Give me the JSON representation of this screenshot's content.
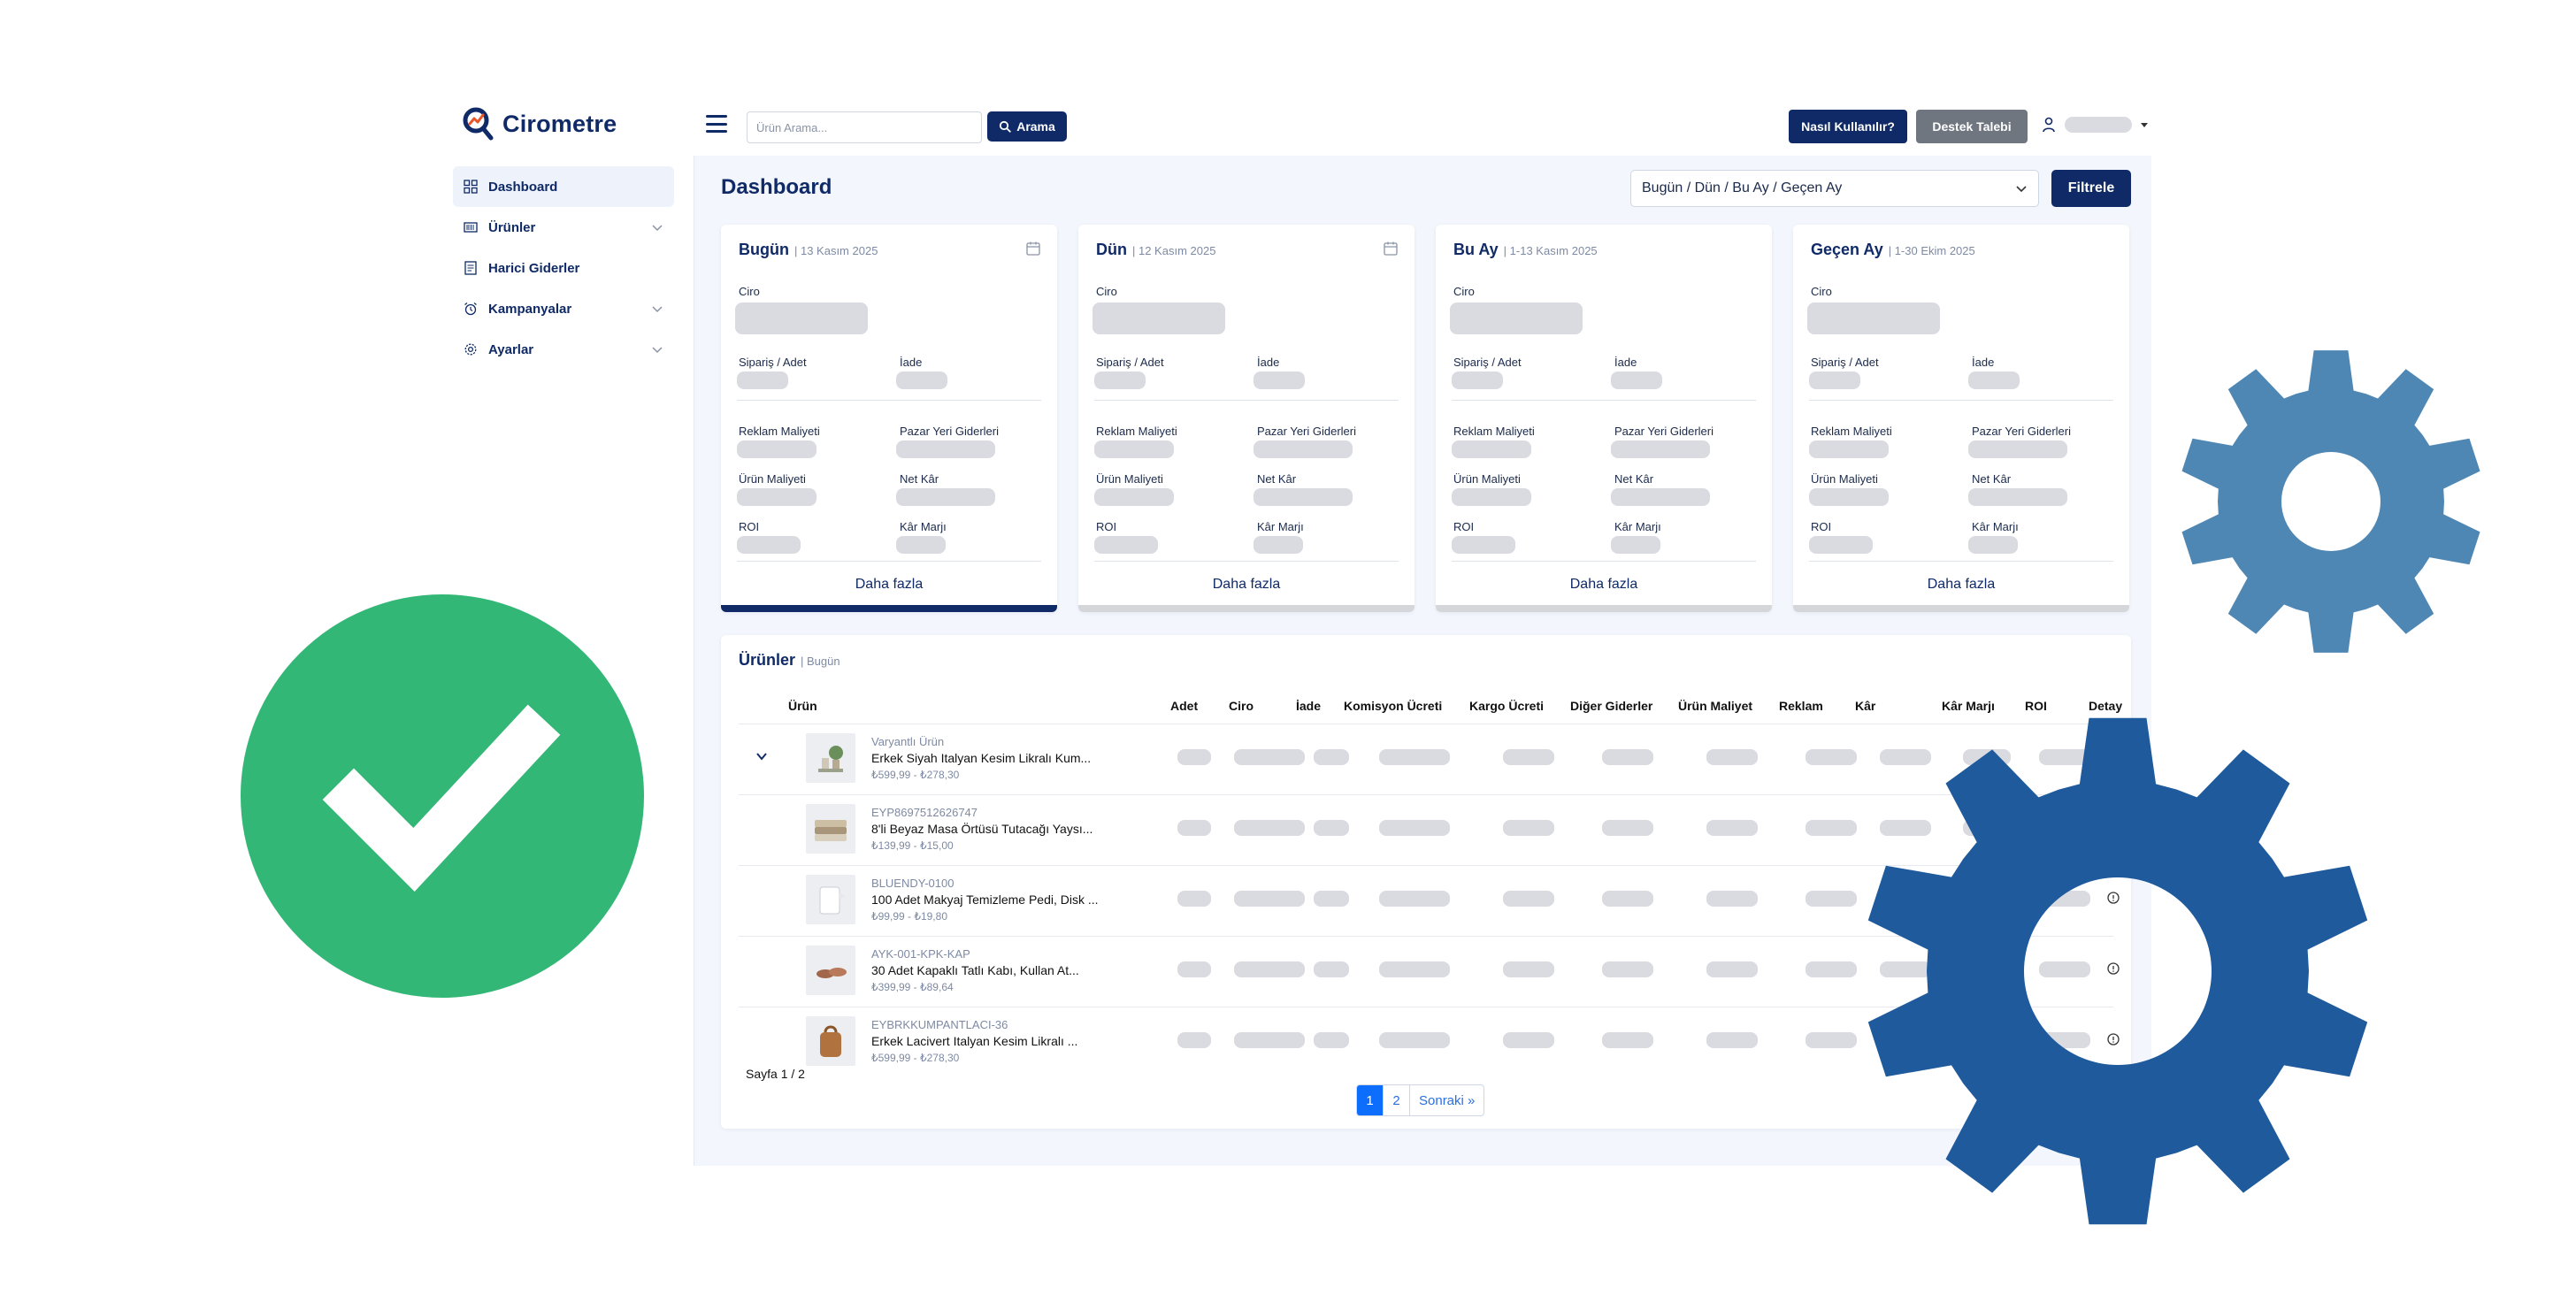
{
  "app": {
    "brand": "Cirometre",
    "search_placeholder": "Ürün Arama...",
    "search_button": "Arama",
    "howto_button": "Nasıl Kullanılır?",
    "support_button": "Destek Talebi"
  },
  "sidebar": {
    "items": [
      {
        "label": "Dashboard",
        "icon": "grid-icon"
      },
      {
        "label": "Ürünler",
        "icon": "barcode-icon"
      },
      {
        "label": "Harici Giderler",
        "icon": "document-icon"
      },
      {
        "label": "Kampanyalar",
        "icon": "alarm-icon"
      },
      {
        "label": "Ayarlar",
        "icon": "gear-icon"
      }
    ]
  },
  "dashboard": {
    "title": "Dashboard",
    "period_selected": "Bugün / Dün / Bu Ay / Geçen Ay",
    "filter_button": "Filtrele"
  },
  "cards": [
    {
      "title": "Bugün",
      "date": "| 13 Kasım 2025"
    },
    {
      "title": "Dün",
      "date": "| 12 Kasım 2025"
    },
    {
      "title": "Bu Ay",
      "date": "| 1-13 Kasım 2025"
    },
    {
      "title": "Geçen Ay",
      "date": "| 1-30 Ekim 2025"
    }
  ],
  "card_labels": {
    "ciro": "Ciro",
    "siparis": "Sipariş / Adet",
    "iade": "İade",
    "reklam": "Reklam Maliyeti",
    "pazar": "Pazar Yeri Giderleri",
    "urun_maliyet": "Ürün Maliyeti",
    "net_kar": "Net Kâr",
    "roi": "ROI",
    "kar_marji": "Kâr Marjı",
    "more": "Daha fazla"
  },
  "products": {
    "title": "Ürünler",
    "subtitle": "| Bugün",
    "headers": [
      "Ürün",
      "Adet",
      "Ciro",
      "İade",
      "Komisyon Ücreti",
      "Kargo Ücreti",
      "Diğer Giderler",
      "Ürün Maliyet",
      "Reklam",
      "Kâr",
      "Kâr Marjı",
      "ROI",
      "Detay"
    ],
    "rows": [
      {
        "sku": "Varyantlı Ürün",
        "name": "Erkek Siyah Italyan Kesim Likralı Kum...",
        "price": "₺599,99 - ₺278,30"
      },
      {
        "sku": "EYP8697512626747",
        "name": "8'li Beyaz Masa Örtüsü Tutacağı Yaysı...",
        "price": "₺139,99 - ₺15,00"
      },
      {
        "sku": "BLUENDY-0100",
        "name": "100 Adet Makyaj Temizleme Pedi, Disk ...",
        "price": "₺99,99 - ₺19,80"
      },
      {
        "sku": "AYK-001-KPK-KAP",
        "name": "30 Adet Kapaklı Tatlı Kabı, Kullan At...",
        "price": "₺399,99 - ₺89,64"
      },
      {
        "sku": "EYBRKKUMPANTLACI-36",
        "name": "Erkek Lacivert Italyan Kesim Likralı ...",
        "price": "₺599,99 - ₺278,30"
      }
    ],
    "page_info": "Sayfa 1 / 2",
    "pages": [
      "1",
      "2",
      "Sonraki »"
    ]
  },
  "colors": {
    "brand": "#0f2a66",
    "check": "#33b776",
    "gear_light": "#4f87b4",
    "gear_dark": "#1e5a9c"
  }
}
